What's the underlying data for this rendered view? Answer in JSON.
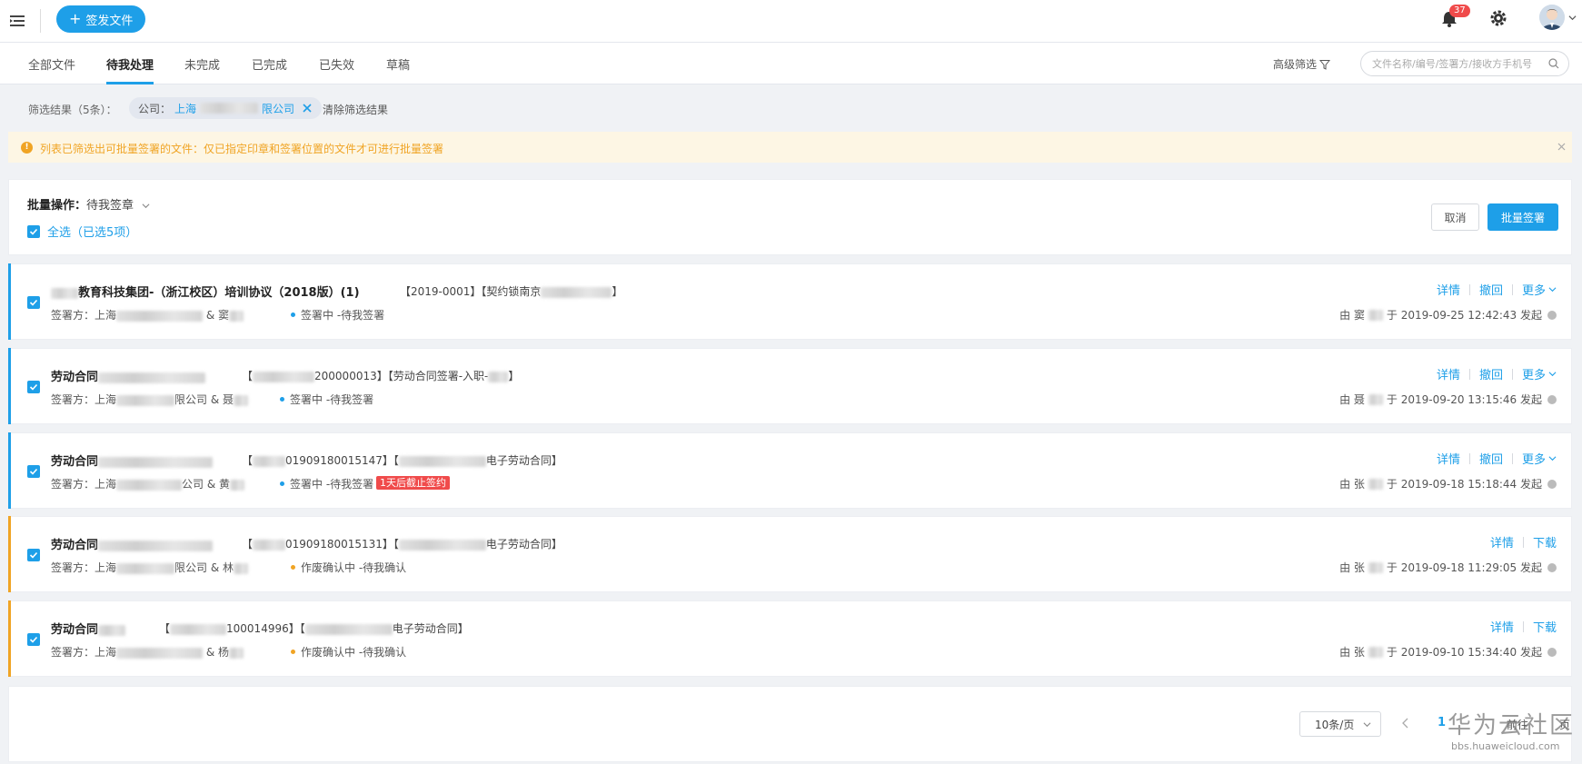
{
  "header": {
    "send_button_label": "签发文件",
    "notification_count": "37"
  },
  "tabs": [
    {
      "label": "全部文件"
    },
    {
      "label": "待我处理"
    },
    {
      "label": "未完成"
    },
    {
      "label": "已完成"
    },
    {
      "label": "已失效"
    },
    {
      "label": "草稿"
    }
  ],
  "toolbar": {
    "advanced_filter_label": "高级筛选",
    "search_placeholder": "文件名称/编号/签署方/接收方手机号"
  },
  "filter": {
    "result_label": "筛选结果（5条）：",
    "chip_key": "公司：",
    "chip_value_prefix": "上海",
    "chip_value_suffix": "限公司",
    "clear_label": "清除筛选结果"
  },
  "notice": {
    "text": "列表已筛选出可批量签署的文件：仅已指定印章和签署位置的文件才可进行批量签署"
  },
  "batch": {
    "label": "批量操作：",
    "value": "待我签章",
    "select_all_label": "全选（已选5项）",
    "cancel_label": "取消",
    "batch_sign_label": "批量签署"
  },
  "colors": {
    "accent": "#1e9fe8",
    "signing_stripe": "#1e9fe8",
    "void_stripe": "#f0a424",
    "danger": "#f04b4b"
  },
  "documents": [
    {
      "title": "教育科技集团-（浙江校区）培训协议（2018版）(1)",
      "code": "【2019-0001】【契约锁南京",
      "code_end": "】",
      "signer_prefix": "签署方：上海",
      "signer_mid": " & 窦",
      "status": "签署中 -待我签署",
      "deadline": "",
      "meta_prefix": "由 窦",
      "meta_time": "于 2019-09-25 12:42:43 发起",
      "actions": [
        "详情",
        "撤回",
        "更多"
      ],
      "kind": "signing"
    },
    {
      "title": "劳动合同",
      "code": "200000013】【劳动合同签署-入职-",
      "code_end": "】",
      "signer_prefix": "签署方：上海",
      "signer_mid": "限公司 & 聂",
      "status": "签署中 -待我签署",
      "deadline": "",
      "meta_prefix": "由 聂",
      "meta_time": "于 2019-09-20 13:15:46 发起",
      "actions": [
        "详情",
        "撤回",
        "更多"
      ],
      "kind": "signing"
    },
    {
      "title": "劳动合同",
      "code": "01909180015147】【",
      "code_end": "电子劳动合同】",
      "signer_prefix": "签署方：上海",
      "signer_mid": "公司 & 黄",
      "status": "签署中 -待我签署",
      "deadline": "1天后截止签约",
      "meta_prefix": "由 张",
      "meta_time": "于 2019-09-18 15:18:44 发起",
      "actions": [
        "详情",
        "撤回",
        "更多"
      ],
      "kind": "signing"
    },
    {
      "title": "劳动合同",
      "code": "01909180015131】【",
      "code_end": "电子劳动合同】",
      "signer_prefix": "签署方：上海",
      "signer_mid": "限公司 & 林",
      "status": "作废确认中 -待我确认",
      "deadline": "",
      "meta_prefix": "由 张",
      "meta_time": "于 2019-09-18 11:29:05 发起",
      "actions": [
        "详情",
        "下载"
      ],
      "kind": "void"
    },
    {
      "title": "劳动合同",
      "code": "100014996】【",
      "code_end": "电子劳动合同】",
      "signer_prefix": "签署方：上海",
      "signer_mid": " & 杨",
      "status": "作废确认中 -待我确认",
      "deadline": "",
      "meta_prefix": "由 张",
      "meta_time": "于 2019-09-10 15:34:40 发起",
      "actions": [
        "详情",
        "下载"
      ],
      "kind": "void"
    }
  ],
  "pagination": {
    "page_size_label": "10条/页",
    "current_page": "1",
    "goto_label": "前往",
    "page_suffix": "页"
  },
  "watermark": {
    "main": "华为云社区",
    "url": "bbs.huaweicloud.com"
  }
}
